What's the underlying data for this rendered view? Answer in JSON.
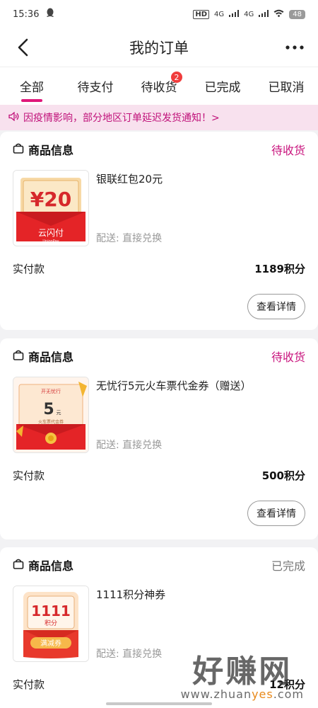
{
  "status_bar": {
    "time": "15:36",
    "network1": "HD",
    "network2": "4G",
    "network3": "4G",
    "battery": "48"
  },
  "nav": {
    "title": "我的订单"
  },
  "tabs": [
    {
      "label": "全部",
      "active": true
    },
    {
      "label": "待支付"
    },
    {
      "label": "待收货",
      "badge": "2"
    },
    {
      "label": "已完成"
    },
    {
      "label": "已取消"
    }
  ],
  "notice": {
    "text": "因疫情影响，部分地区订单延迟发货通知！>"
  },
  "orders": [
    {
      "section_label": "商品信息",
      "status": "待收货",
      "product_name": "银联红包20元",
      "delivery": "配送: 直接兑换",
      "pay_label": "实付款",
      "pay_value": "1189积分",
      "detail_label": "查看详情",
      "thumb": {
        "amount": "¥20",
        "brand": "云闪付",
        "brand_sub": "UnionPay"
      }
    },
    {
      "section_label": "商品信息",
      "status": "待收货",
      "product_name": "无忧行5元火车票代金券（赠送）",
      "delivery": "配送: 直接兑换",
      "pay_label": "实付款",
      "pay_value": "500积分",
      "detail_label": "查看详情",
      "thumb": {
        "amount": "5",
        "unit": "元",
        "caption": "火车票代金券",
        "logo": "开无忧行"
      }
    },
    {
      "section_label": "商品信息",
      "status": "已完成",
      "product_name": "1111积分神券",
      "delivery": "配送: 直接兑换",
      "pay_label": "实付款",
      "pay_value": "12积分",
      "thumb": {
        "amount": "1111",
        "unit": "积分",
        "tag": "满减券"
      }
    }
  ],
  "watermark": {
    "big": "好赚网",
    "small_pre": "www.zhuan",
    "small_hl": "yes",
    "small_post": ".com"
  },
  "colors": {
    "accent": "#e0187a",
    "status_pending": "#c9157e",
    "badge": "#f03c3c"
  }
}
